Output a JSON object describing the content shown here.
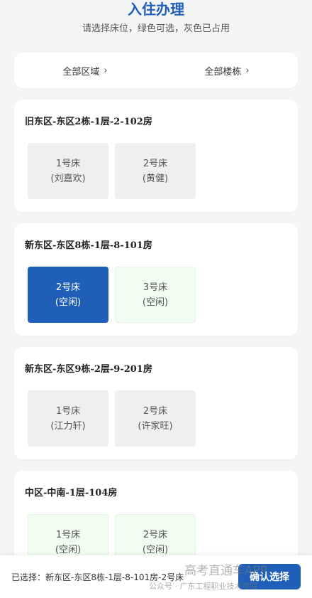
{
  "header": {
    "title": "入住办理",
    "subtitle": "请选择床位，绿色可选，灰色已占用"
  },
  "filters": {
    "area": "全部区域",
    "building": "全部楼栋",
    "chevron": "›"
  },
  "rooms": [
    {
      "title": "旧东区-东区2栋-1层-2-102房",
      "beds": [
        {
          "name": "1号床",
          "status": "(刘嘉欢)",
          "state": "occupied"
        },
        {
          "name": "2号床",
          "status": "(黄健)",
          "state": "occupied"
        }
      ]
    },
    {
      "title": "新东区-东区8栋-1层-8-101房",
      "beds": [
        {
          "name": "2号床",
          "status": "(空闲)",
          "state": "selected"
        },
        {
          "name": "3号床",
          "status": "(空闲)",
          "state": "free"
        }
      ]
    },
    {
      "title": "新东区-东区9栋-2层-9-201房",
      "beds": [
        {
          "name": "1号床",
          "status": "(江力轩)",
          "state": "occupied"
        },
        {
          "name": "2号床",
          "status": "(许家旺)",
          "state": "occupied"
        }
      ]
    },
    {
      "title": "中区-中南-1层-104房",
      "beds": [
        {
          "name": "1号床",
          "status": "(空闲)",
          "state": "free"
        },
        {
          "name": "2号床",
          "status": "(空闲)",
          "state": "free"
        }
      ]
    }
  ],
  "bottom": {
    "selected_text": "已选择：新东区-东区8栋-1层-8-101房-2号床",
    "confirm_label": "确认选择"
  },
  "watermark": {
    "app": "高考直通车APP",
    "account": "公众号 · 广东工程职业技术学院"
  },
  "colors": {
    "primary": "#1f5fb8",
    "free_bg": "#f1fdf0",
    "occupied_bg": "#efefef"
  }
}
